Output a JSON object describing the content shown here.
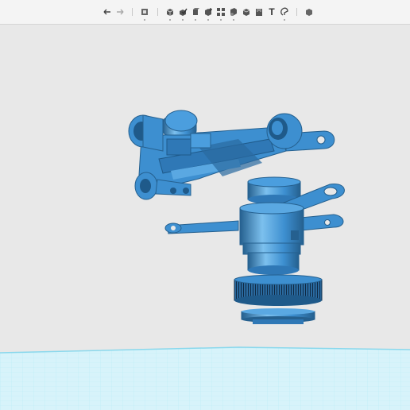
{
  "toolbar": {
    "text_tool_glyph": "T",
    "items": [
      {
        "name": "undo-icon"
      },
      {
        "name": "redo-icon"
      },
      {
        "name": "view-cube-icon"
      },
      {
        "name": "primitive-box-icon"
      },
      {
        "name": "sketch-icon"
      },
      {
        "name": "construct-icon"
      },
      {
        "name": "modify-icon"
      },
      {
        "name": "pattern-icon"
      },
      {
        "name": "group-icon"
      },
      {
        "name": "combine-icon"
      },
      {
        "name": "measure-icon"
      },
      {
        "name": "text-icon"
      },
      {
        "name": "snap-icon"
      },
      {
        "name": "material-icon"
      }
    ]
  },
  "colors": {
    "model": "#3d8fd0",
    "model_dark": "#25608f",
    "model_light": "#7cc0ee",
    "background": "#e8e8e8",
    "grid": "#a8e6f4"
  }
}
